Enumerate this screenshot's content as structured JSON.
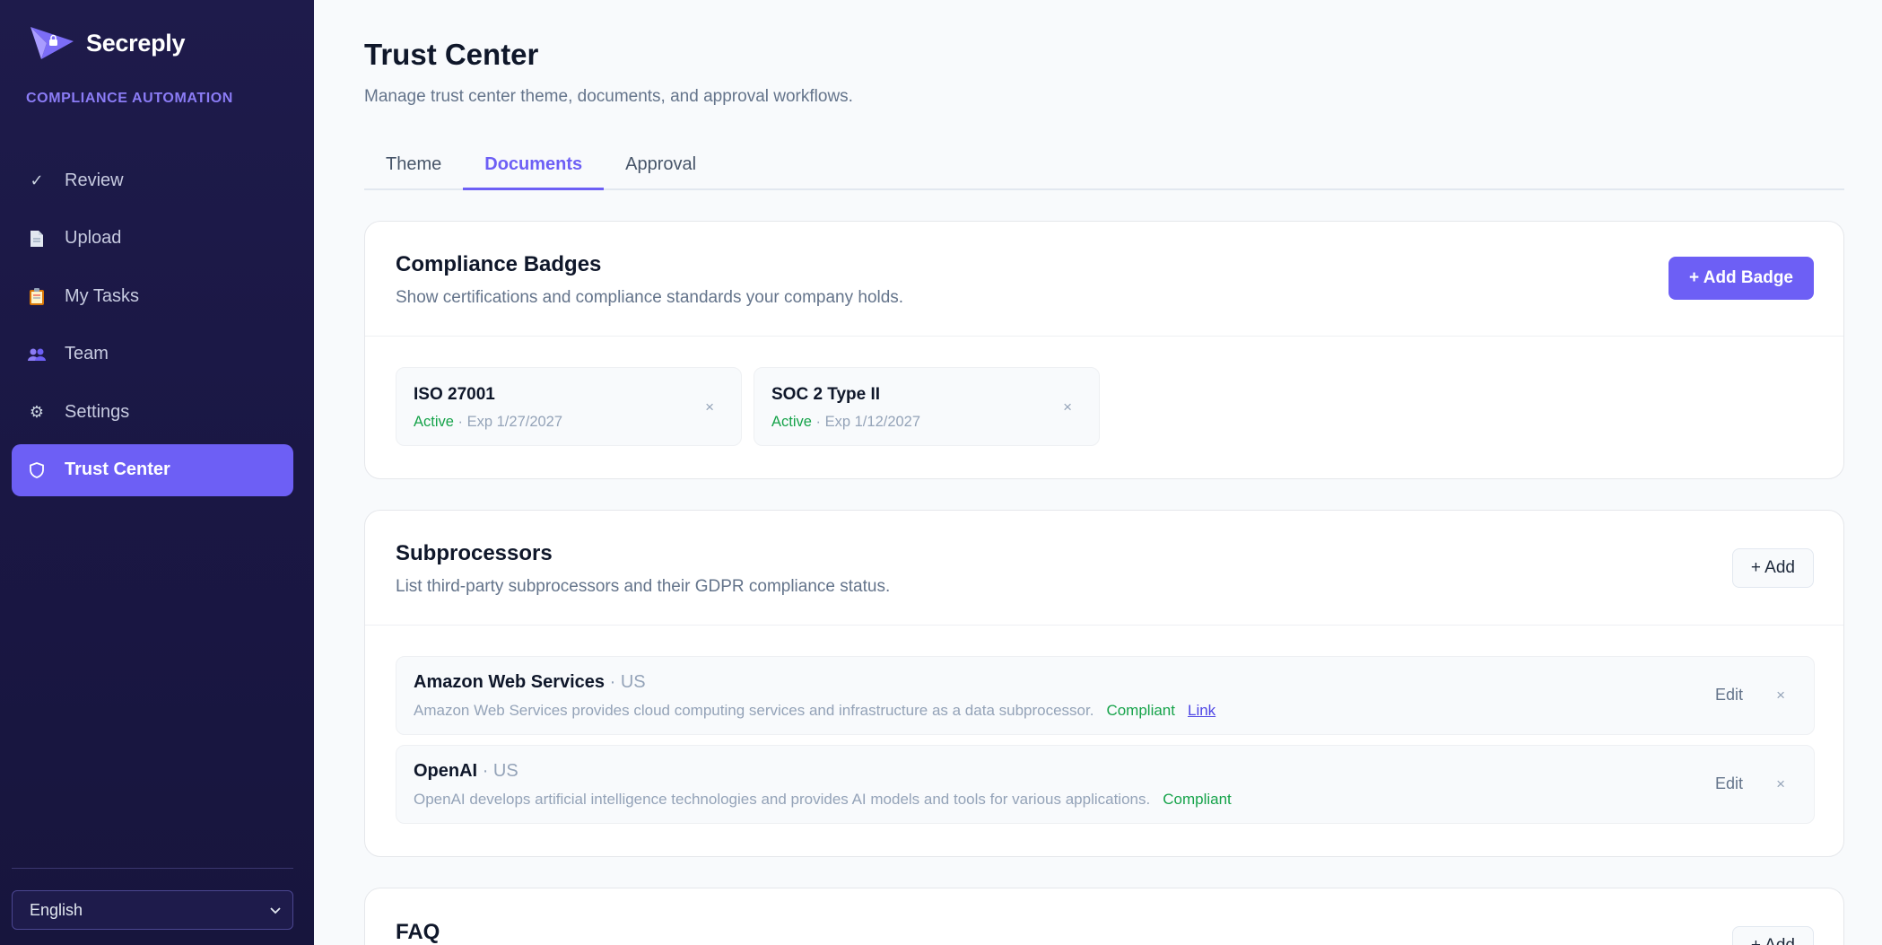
{
  "sidebar": {
    "brand": "Secreply",
    "tagline": "COMPLIANCE AUTOMATION",
    "items": [
      {
        "label": "Review",
        "icon": "check-icon"
      },
      {
        "label": "Upload",
        "icon": "document-icon"
      },
      {
        "label": "My Tasks",
        "icon": "clipboard-icon"
      },
      {
        "label": "Team",
        "icon": "people-icon"
      },
      {
        "label": "Settings",
        "icon": "gear-icon"
      },
      {
        "label": "Trust Center",
        "icon": "shield-icon",
        "active": true
      }
    ],
    "language": "English"
  },
  "header": {
    "title": "Trust Center",
    "subtitle": "Manage trust center theme, documents, and approval workflows."
  },
  "tabs": [
    {
      "label": "Theme"
    },
    {
      "label": "Documents",
      "active": true
    },
    {
      "label": "Approval"
    }
  ],
  "badges_section": {
    "title": "Compliance Badges",
    "description": "Show certifications and compliance standards your company holds.",
    "add_label": "+ Add Badge",
    "items": [
      {
        "name": "ISO 27001",
        "status": "Active",
        "expiry": "· Exp 1/27/2027"
      },
      {
        "name": "SOC 2 Type II",
        "status": "Active",
        "expiry": "· Exp 1/12/2027"
      }
    ]
  },
  "subprocessors_section": {
    "title": "Subprocessors",
    "description": "List third-party subprocessors and their GDPR compliance status.",
    "add_label": "+ Add",
    "items": [
      {
        "name": "Amazon Web Services",
        "location": "· US",
        "description": "Amazon Web Services provides cloud computing services and infrastructure as a data subprocessor.",
        "status": "Compliant",
        "link": "Link",
        "edit": "Edit"
      },
      {
        "name": "OpenAI",
        "location": "· US",
        "description": "OpenAI develops artificial intelligence technologies and provides AI models and tools for various applications.",
        "status": "Compliant",
        "edit": "Edit"
      }
    ]
  },
  "faq_section": {
    "title": "FAQ",
    "add_label": "+ Add"
  },
  "colors": {
    "accent": "#6d5ff5",
    "sidebar_bg": "#1e1b4b",
    "success": "#16a34a"
  }
}
